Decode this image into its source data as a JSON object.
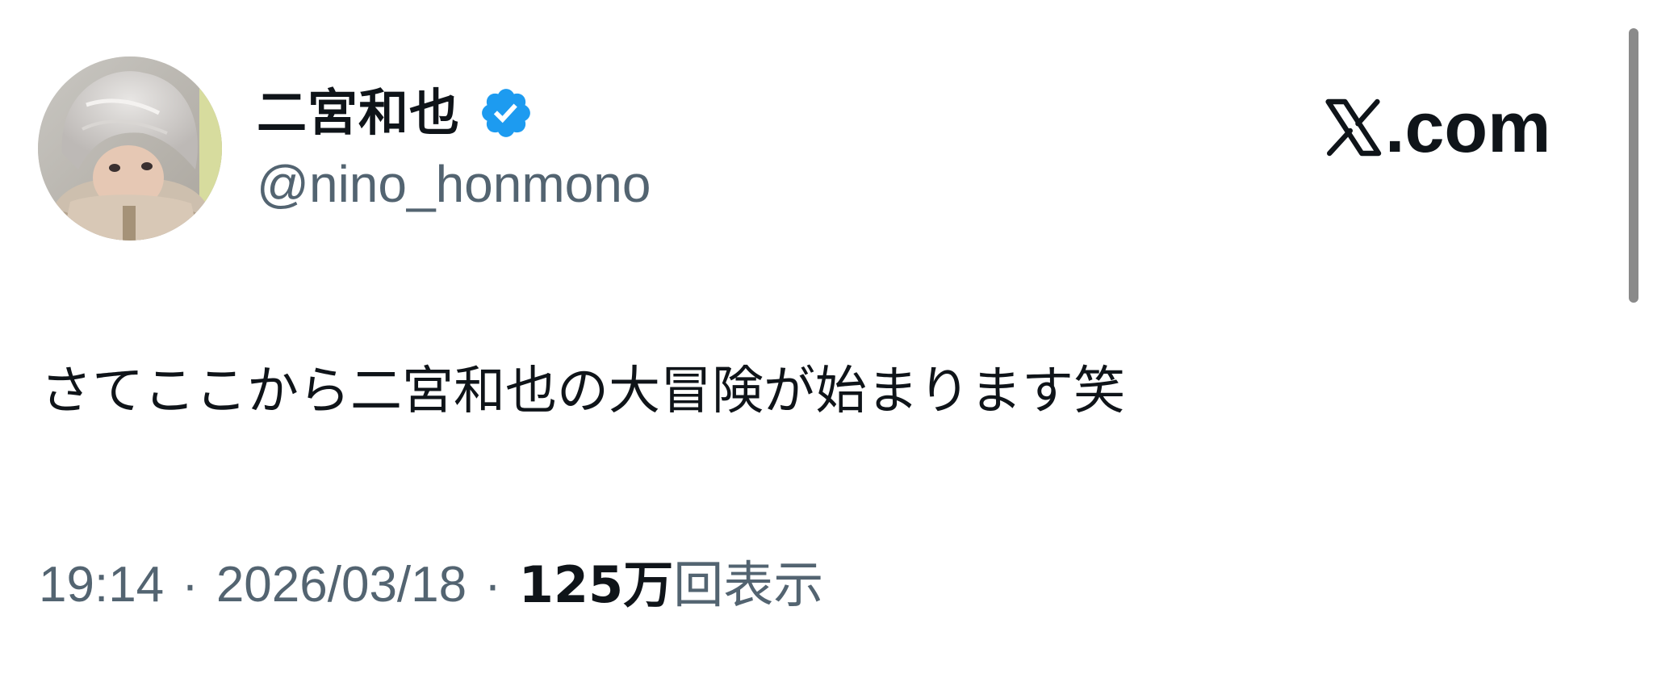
{
  "author": {
    "display_name": "二宮和也",
    "handle": "@nino_honmono",
    "verified": true,
    "verified_color": "#1d9bf0"
  },
  "brand": {
    "icon": "x-logo-icon",
    "text": ".com"
  },
  "tweet": {
    "text": "さてここから二宮和也の大冒険が始まります笑"
  },
  "meta": {
    "time": "19:14",
    "separator": "·",
    "date": "2026/03/18",
    "view_count": "125万",
    "view_label": "回表示"
  },
  "colors": {
    "primary_text": "#0f1419",
    "secondary_text": "#536471",
    "background": "#ffffff"
  }
}
